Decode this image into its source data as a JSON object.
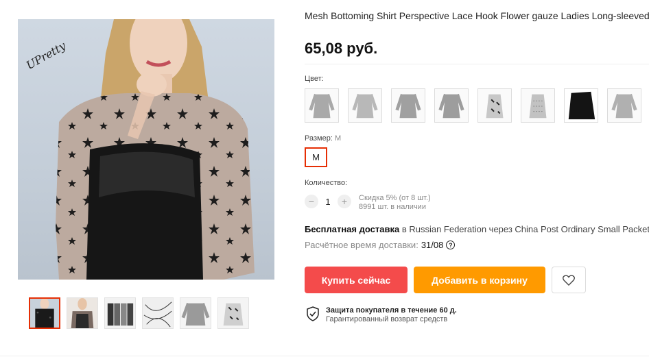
{
  "product": {
    "title": "Mesh Bottoming Shirt Perspective Lace Hook Flower gauze Ladies Long-sleeved Black",
    "price": "65,08 руб.",
    "watermark": "UPretty"
  },
  "gallery": {
    "thumbnails": [
      "thumbnail-1",
      "thumbnail-2",
      "thumbnail-3",
      "thumbnail-4",
      "thumbnail-5",
      "thumbnail-6"
    ]
  },
  "color": {
    "label": "Цвет:",
    "options": [
      "color-1",
      "color-2",
      "color-3",
      "color-4",
      "color-5",
      "color-6",
      "color-7",
      "color-8"
    ]
  },
  "size": {
    "label": "Размер:",
    "selected": "M",
    "option": "M"
  },
  "quantity": {
    "label": "Количество:",
    "minus": "−",
    "value": "1",
    "plus": "+",
    "discount": "Скидка 5% (от 8 шт.)",
    "stock": "8991 шт. в наличии"
  },
  "shipping": {
    "free": "Бесплатная доставка",
    "details": " в Russian Federation через China Post Ordinary Small Packet",
    "time_label": "Расчётное время доставки:",
    "time_value": "31/08",
    "help": "?"
  },
  "actions": {
    "buy": "Купить сейчас",
    "cart": "Добавить в корзину",
    "wishlist_icon": "heart-icon"
  },
  "protection": {
    "title": "Защита покупателя в течение 60 д.",
    "subtitle": "Гарантированный возврат средств"
  },
  "colors": {
    "accent": "#e62e04",
    "buy_button": "#f44b4b",
    "cart_button": "#ff9a00"
  }
}
